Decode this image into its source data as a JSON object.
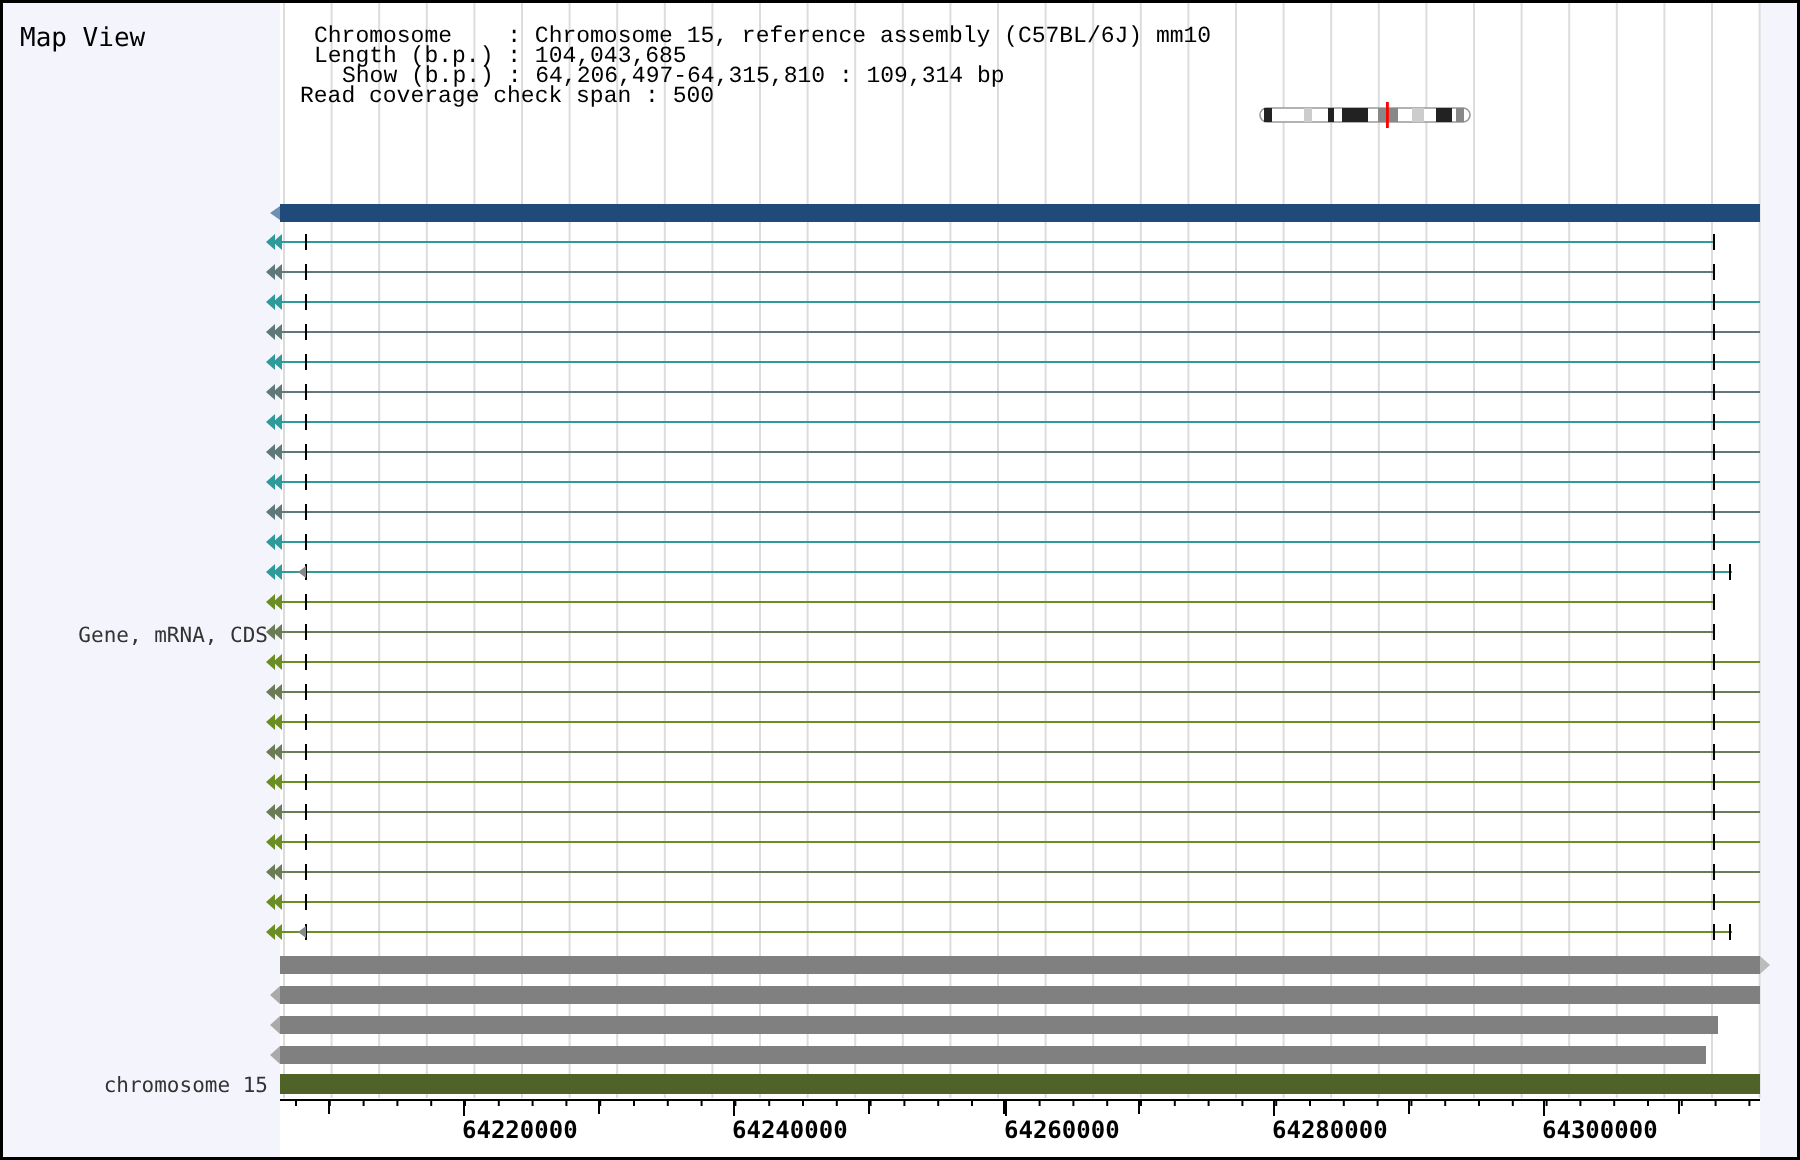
{
  "title": "Map View",
  "info_lines": [
    "Chromosome    : Chromosome 15, reference assembly (C57BL/6J) mm10",
    "Length (b.p.) : 104,043,685",
    "Show (b.p.) : 64,206,497-64,315,810 : 109,314 bp",
    "Read coverage check span : 500"
  ],
  "track_label": "Gene, mRNA, CDS",
  "transcripts": [
    {
      "kind": "short",
      "color": "#2f9a9a"
    },
    {
      "kind": "short",
      "color": "#5f7878"
    },
    {
      "kind": "full",
      "color": "#2f9a9a"
    },
    {
      "kind": "full",
      "color": "#5f7878"
    },
    {
      "kind": "full",
      "color": "#2f9a9a"
    },
    {
      "kind": "full",
      "color": "#5f7878"
    },
    {
      "kind": "full",
      "color": "#2f9a9a"
    },
    {
      "kind": "full",
      "color": "#5f7878"
    },
    {
      "kind": "full",
      "color": "#2f9a9a"
    },
    {
      "kind": "full",
      "color": "#5f7878"
    },
    {
      "kind": "full",
      "color": "#2f9a9a"
    },
    {
      "kind": "extended",
      "color": "#2f9a9a"
    },
    {
      "kind": "short",
      "color": "#6b8e23"
    },
    {
      "kind": "short",
      "color": "#6b7b55"
    },
    {
      "kind": "full",
      "color": "#6b8e23"
    },
    {
      "kind": "full",
      "color": "#6b7b55"
    },
    {
      "kind": "full",
      "color": "#6b8e23"
    },
    {
      "kind": "full",
      "color": "#6b7b55"
    },
    {
      "kind": "full",
      "color": "#6b8e23"
    },
    {
      "kind": "full",
      "color": "#6b7b55"
    },
    {
      "kind": "full",
      "color": "#6b8e23"
    },
    {
      "kind": "full",
      "color": "#6b7b55"
    },
    {
      "kind": "full",
      "color": "#6b8e23"
    },
    {
      "kind": "extended",
      "color": "#6b8e23"
    }
  ],
  "reads": [
    {
      "kind": "forward"
    },
    {
      "kind": "reverse"
    },
    {
      "kind": "reverse-short"
    },
    {
      "kind": "reverse-shorter"
    }
  ],
  "chromosome_track": {
    "label": "chromosome 15"
  },
  "axis_labels": [
    "64220000",
    "64240000",
    "64260000",
    "64280000",
    "64300000"
  ]
}
